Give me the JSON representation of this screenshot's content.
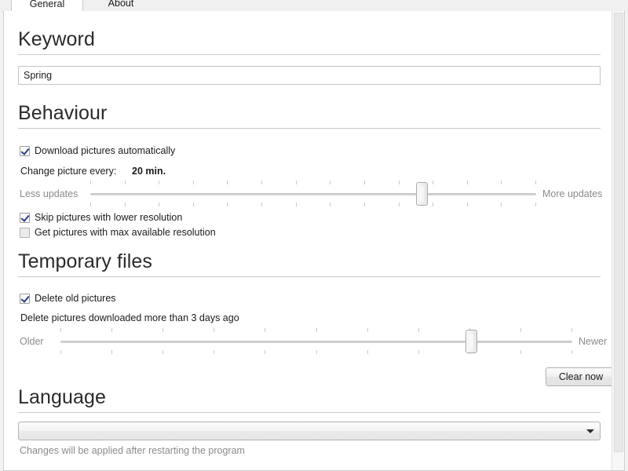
{
  "window": {
    "tabs": [
      {
        "label": "General",
        "selected": true
      },
      {
        "label": "About",
        "selected": false
      }
    ]
  },
  "keyword": {
    "heading": "Keyword",
    "value": "Spring",
    "placeholder": ""
  },
  "behaviour": {
    "heading": "Behaviour",
    "download_auto": {
      "label": "Download pictures automatically",
      "checked": true
    },
    "interval_prefix": "Change picture every:",
    "interval_value": "20 min.",
    "slider": {
      "left_label": "Less updates",
      "right_label": "More updates",
      "tick_count": 14,
      "position_percent": 75
    },
    "skip_low_res": {
      "label": "Skip pictures with lower resolution",
      "checked": true
    },
    "max_res": {
      "label": "Get pictures with max available resolution",
      "checked": false
    }
  },
  "temporary_files": {
    "heading": "Temporary files",
    "delete_old": {
      "label": "Delete old pictures",
      "checked": true
    },
    "age_text": "Delete pictures downloaded more than 3 days ago",
    "age_days": "3",
    "slider": {
      "left_label": "Older",
      "right_label": "Newer",
      "tick_count": 11,
      "position_percent": 81
    },
    "clear_button": "Clear now"
  },
  "language": {
    "heading": "Language",
    "selected": "",
    "note": "Changes will be applied after restarting the program"
  },
  "colors": {
    "accent_check": "#2c3a8c",
    "heading_text": "#2a2a2a",
    "dim_text": "#8b8b8b",
    "rule": "#c9c9c9",
    "panel_bg": "#ffffff"
  }
}
